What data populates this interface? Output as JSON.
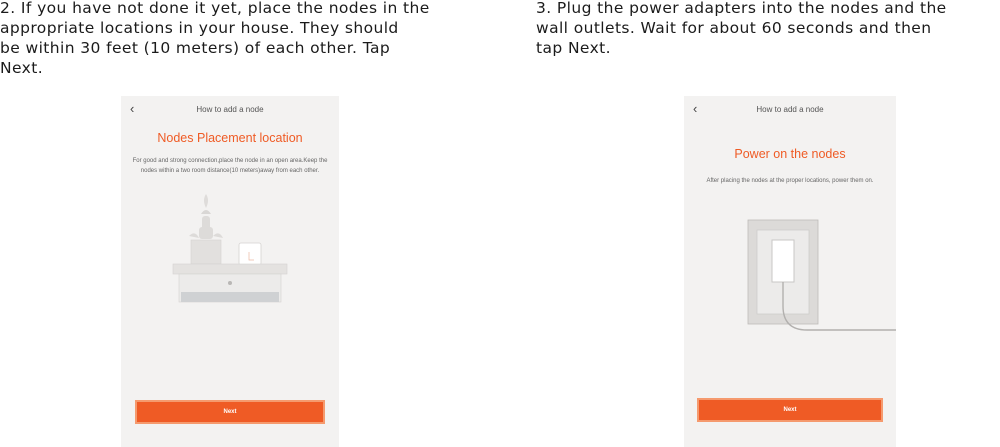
{
  "step2": {
    "text": "2. If you have not done it yet, place the nodes in the\nappropriate locations in your house. They should\nbe within 30 feet (10 meters) of each other. Tap\nNext."
  },
  "step3": {
    "text": "3. Plug the power adapters into the nodes and the\nwall outlets. Wait for about 60 seconds and then\ntap Next."
  },
  "phone_left": {
    "back_icon": "chevron-left-icon",
    "header_title": "How to add a node",
    "heading": "Nodes Placement location",
    "description": "For good and strong connection,place the node in an open area.Keep the nodes within a two room distance(10 meters)away from each other.",
    "next_label": "Next",
    "colors": {
      "accent": "#ef5b25",
      "background": "#f3f2f1"
    }
  },
  "phone_right": {
    "back_icon": "chevron-left-icon",
    "header_title": "How to add a node",
    "heading": "Power on the nodes",
    "description": "After placing the nodes at the proper locations, power them on.",
    "next_label": "Next",
    "colors": {
      "accent": "#ef5b25",
      "background": "#f3f2f1"
    }
  }
}
